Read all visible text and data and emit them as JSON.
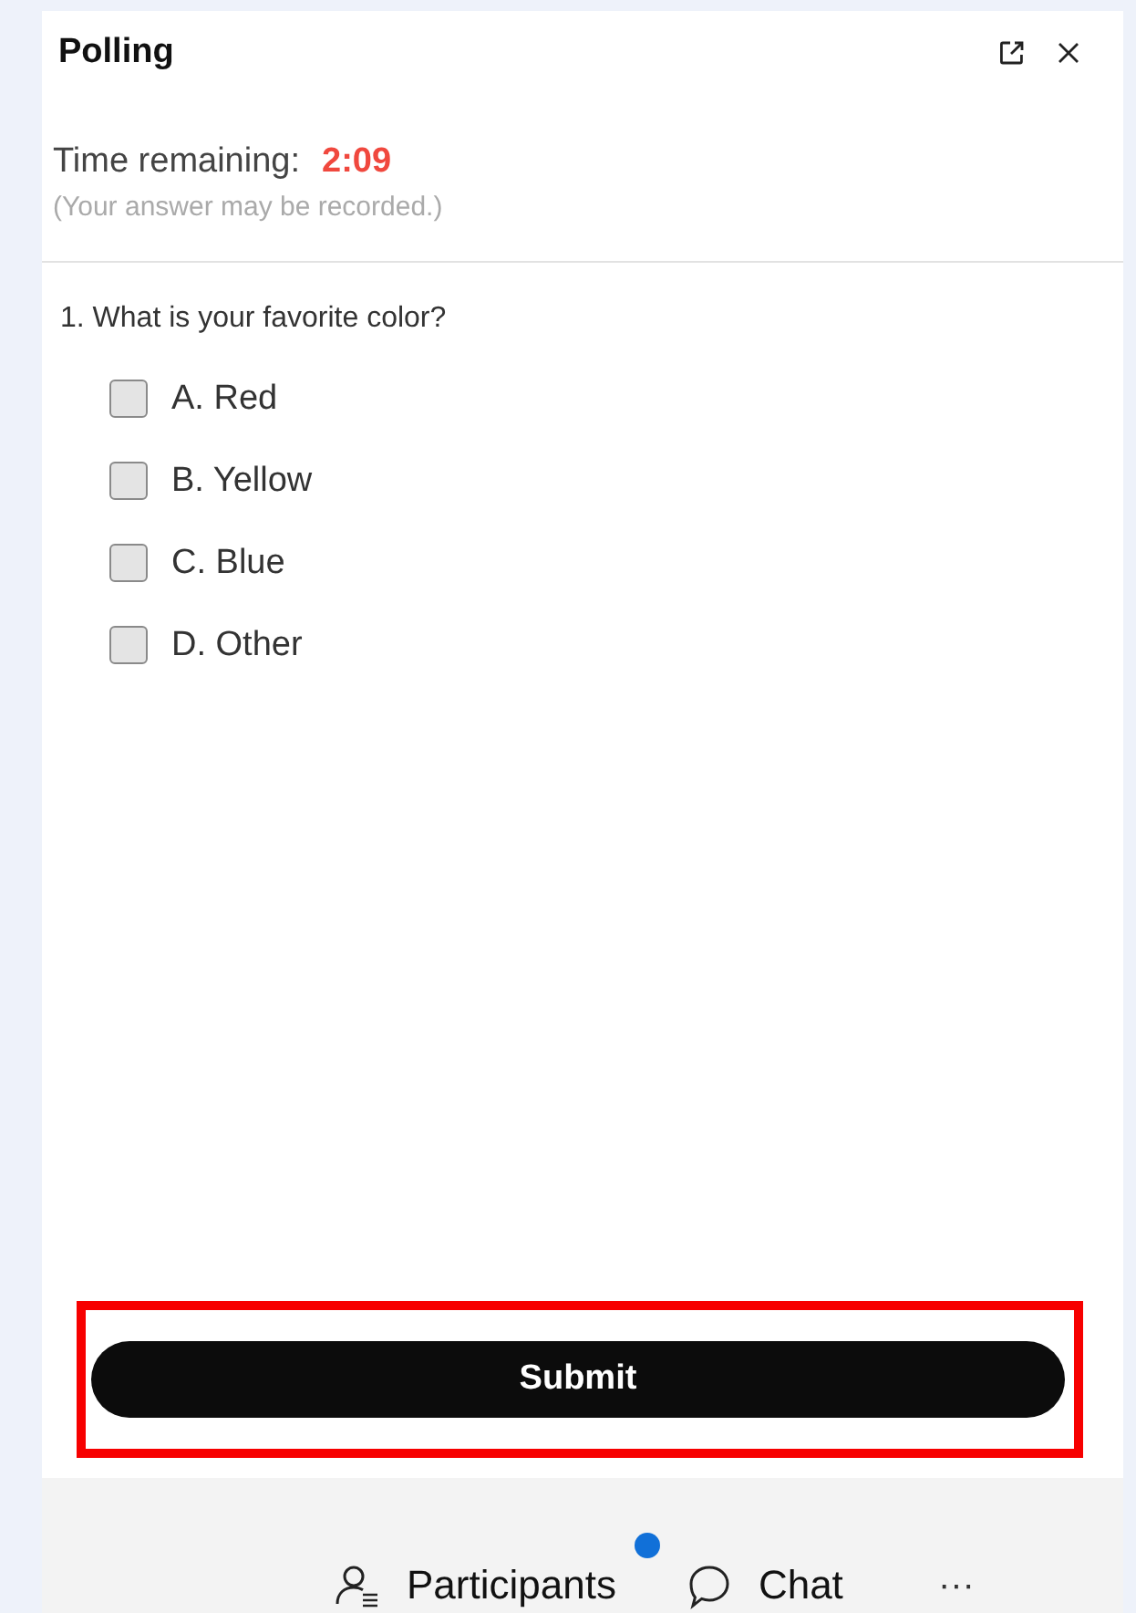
{
  "panel": {
    "title": "Polling",
    "time_label": "Time remaining:",
    "time_value": "2:09",
    "note": "(Your answer may be recorded.)"
  },
  "question": {
    "text": "1. What is your favorite color?",
    "options": [
      {
        "label": "A. Red",
        "checked": false
      },
      {
        "label": "B. Yellow",
        "checked": false
      },
      {
        "label": "C. Blue",
        "checked": false
      },
      {
        "label": "D. Other",
        "checked": false
      }
    ]
  },
  "submit": {
    "label": "Submit",
    "highlighted": true
  },
  "bottom_bar": {
    "items": [
      {
        "kind": "participants",
        "label": "Participants",
        "notification": true
      },
      {
        "kind": "chat",
        "label": "Chat",
        "notification": false
      },
      {
        "kind": "more",
        "label": "···",
        "notification": false
      }
    ]
  }
}
